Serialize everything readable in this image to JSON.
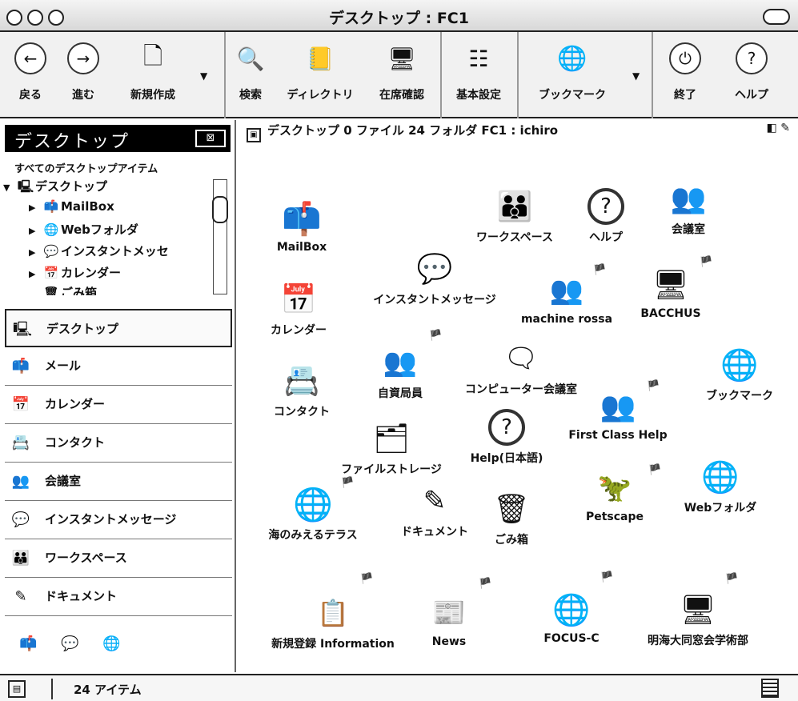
{
  "window": {
    "title": "デスクトップ : FC1"
  },
  "toolbar": {
    "back": "戻る",
    "forward": "進む",
    "new": "新規作成",
    "search": "検索",
    "directory": "ディレクトリ",
    "presence": "在席確認",
    "preferences": "基本設定",
    "bookmarks": "ブックマーク",
    "quit": "終了",
    "help": "ヘルプ"
  },
  "sidebar": {
    "header": "デスクトップ",
    "all_items": "すべてのデスクトップアイテム",
    "tree": [
      {
        "label": "デスクトップ"
      },
      {
        "label": "MailBox"
      },
      {
        "label": "Webフォルダ"
      },
      {
        "label": "インスタントメッセ"
      },
      {
        "label": "カレンダー"
      },
      {
        "label": "ごみ箱"
      }
    ],
    "nav": [
      {
        "label": "デスクトップ"
      },
      {
        "label": "メール"
      },
      {
        "label": "カレンダー"
      },
      {
        "label": "コンタクト"
      },
      {
        "label": "会議室"
      },
      {
        "label": "インスタントメッセージ"
      },
      {
        "label": "ワークスペース"
      },
      {
        "label": "ドキュメント"
      }
    ]
  },
  "main": {
    "path": "デスクトップ  0 ファイル  24 フォルダ   FC1 : ichiro",
    "items": [
      {
        "label": "MailBox"
      },
      {
        "label": "ワークスペース"
      },
      {
        "label": "ヘルプ"
      },
      {
        "label": "会議室"
      },
      {
        "label": "インスタントメッセージ"
      },
      {
        "label": "machine rossa"
      },
      {
        "label": "BACCHUS"
      },
      {
        "label": "カレンダー"
      },
      {
        "label": "自資局員"
      },
      {
        "label": "コンピューター会議室"
      },
      {
        "label": "ブックマーク"
      },
      {
        "label": "コンタクト"
      },
      {
        "label": "First Class Help"
      },
      {
        "label": "ファイルストレージ"
      },
      {
        "label": "Help(日本語)"
      },
      {
        "label": "Webフォルダ"
      },
      {
        "label": "Petscape"
      },
      {
        "label": "海のみえるテラス"
      },
      {
        "label": "ドキュメント"
      },
      {
        "label": "ごみ箱"
      },
      {
        "label": "新規登録 Information"
      },
      {
        "label": "News"
      },
      {
        "label": "FOCUS-C"
      },
      {
        "label": "明海大同窓会学術部"
      }
    ]
  },
  "status": {
    "count": "24 アイテム"
  }
}
